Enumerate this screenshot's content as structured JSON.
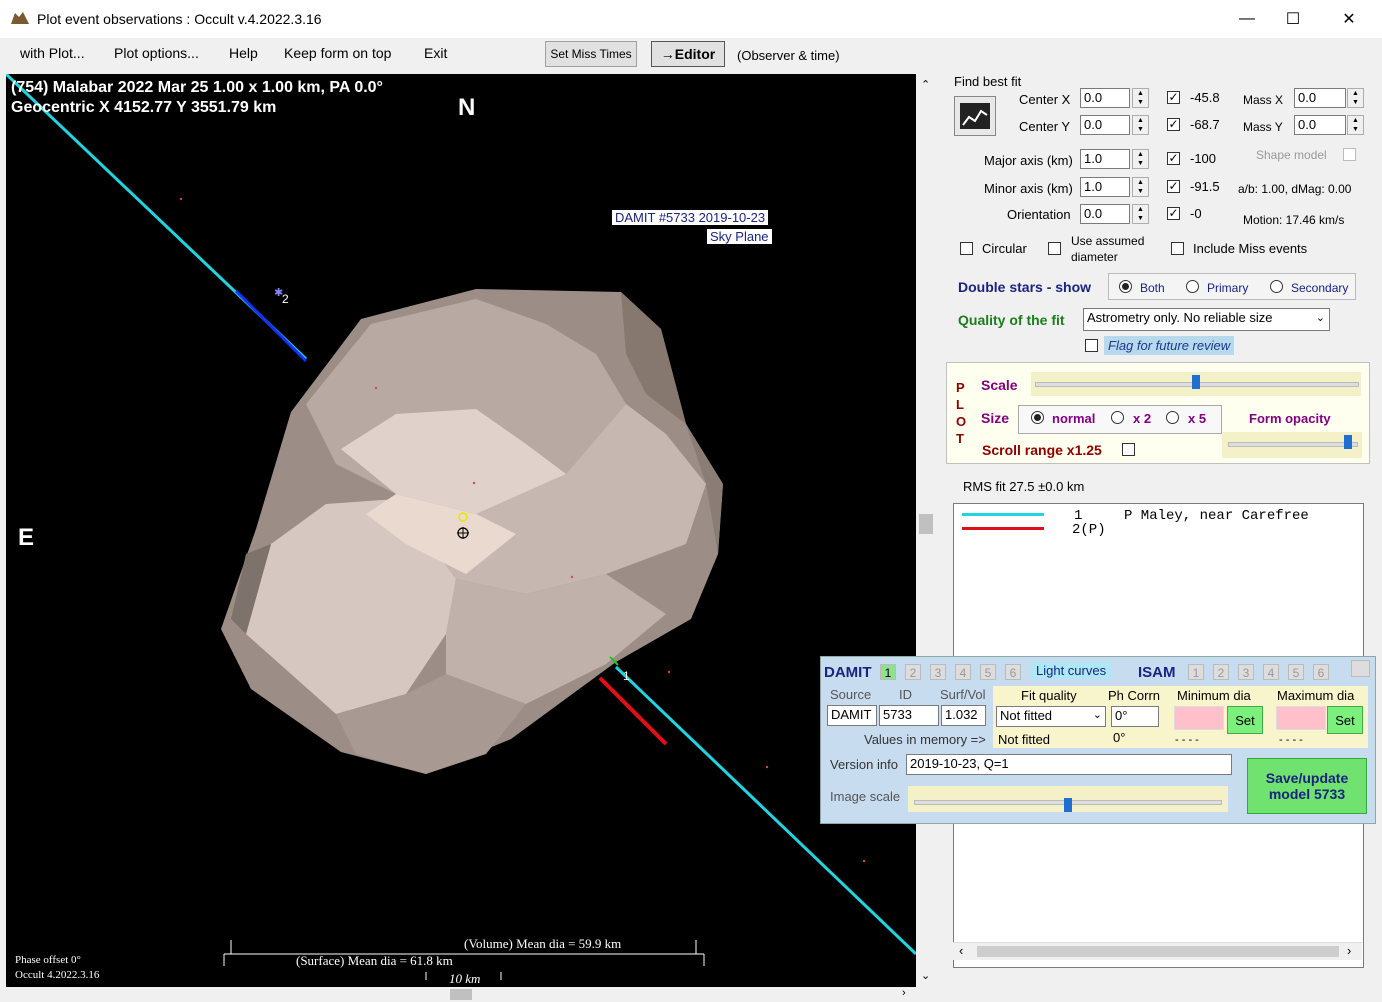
{
  "window": {
    "title": "Plot event observations : Occult v.4.2022.3.16",
    "minimize": "—",
    "maximize": "☐",
    "close": "✕"
  },
  "menu": {
    "with_plot": "with Plot...",
    "plot_options": "Plot options...",
    "help": "Help",
    "keep_on_top": "Keep form on top",
    "exit": "Exit",
    "set_miss_times": "Set Miss Times",
    "editor": "→Editor",
    "observer_time": "(Observer & time)"
  },
  "plot": {
    "header_line1": "(754) Malabar  2022 Mar 25   1.00 x 1.00 km, PA 0.0°",
    "header_line2": "Geocentric  X  4152.77  Y 3551.79 km",
    "north": "N",
    "east": "E",
    "damit_label": "DAMIT #5733 2019-10-23",
    "sky_plane": "Sky Plane",
    "chord1_label": "1",
    "chord2_label": "2",
    "volume_dia": "(Volume) Mean dia = 59.9 km",
    "surface_dia": "(Surface) Mean dia = 61.8 km",
    "scale_bar": "10 km",
    "phase_offset": "Phase offset 0°",
    "version": "Occult 4.2022.3.16"
  },
  "fit": {
    "find_best_fit": "Find best fit",
    "center_x_label": "Center X",
    "center_x": "0.0",
    "center_x_res": "-45.8",
    "center_y_label": "Center Y",
    "center_y": "0.0",
    "center_y_res": "-68.7",
    "mass_x_label": "Mass X",
    "mass_x": "0.0",
    "mass_y_label": "Mass Y",
    "mass_y": "0.0",
    "major_label": "Major axis (km)",
    "major": "1.0",
    "major_res": "-100",
    "minor_label": "Minor axis (km)",
    "minor": "1.0",
    "minor_res": "-91.5",
    "orient_label": "Orientation",
    "orient": "0.0",
    "orient_res": "-0",
    "shape_model": "Shape model",
    "ab_dmag": "a/b: 1.00, dMag: 0.00",
    "motion": "Motion: 17.46 km/s",
    "circular": "Circular",
    "use_assumed_1": "Use assumed",
    "use_assumed_2": "diameter",
    "include_miss": "Include Miss events"
  },
  "double_stars": {
    "label": "Double stars - show",
    "both": "Both",
    "primary": "Primary",
    "secondary": "Secondary"
  },
  "quality": {
    "label": "Quality of the fit",
    "value": "Astrometry only. No reliable size",
    "flag": "Flag for future review"
  },
  "plot_panel": {
    "vertical": [
      "P",
      "L",
      "O",
      "T"
    ],
    "scale": "Scale",
    "scale_value": 0.5,
    "size": "Size",
    "normal": "normal",
    "x2": "x 2",
    "x5": "x 5",
    "form_opacity": "Form opacity",
    "opacity_value": 0.95,
    "scroll_range": "Scroll range x1.25"
  },
  "rms": "RMS fit 27.5 ±0.0 km",
  "legend": [
    {
      "num": "1",
      "observer": "P Maley, near Carefree",
      "color": "#22d3e0"
    },
    {
      "num": "2(P)",
      "observer": "",
      "color": "#e0101a"
    }
  ],
  "damit": {
    "title": "DAMIT",
    "nums": [
      "1",
      "2",
      "3",
      "4",
      "5",
      "6"
    ],
    "light_curves": "Light curves",
    "isam": "ISAM",
    "source_label": "Source",
    "id_label": "ID",
    "surfvol_label": "Surf/Vol",
    "source": "DAMIT",
    "id": "5733",
    "surfvol": "1.032",
    "fit_quality_label": "Fit quality",
    "fit_quality": "Not fitted",
    "ph_corr_label": "Ph Corrn",
    "ph_corr": "0°",
    "min_dia_label": "Minimum dia",
    "max_dia_label": "Maximum dia",
    "set": "Set",
    "values_in_memory": "Values in memory =>",
    "mem_fit": "Not fitted",
    "mem_ph": "0°",
    "mem_min": "- - - -",
    "mem_max": "- - - -",
    "version_label": "Version info",
    "version": "2019-10-23, Q=1",
    "image_scale": "Image scale",
    "image_scale_value": 0.5,
    "save_line1": "Save/update",
    "save_line2": "model 5733"
  }
}
